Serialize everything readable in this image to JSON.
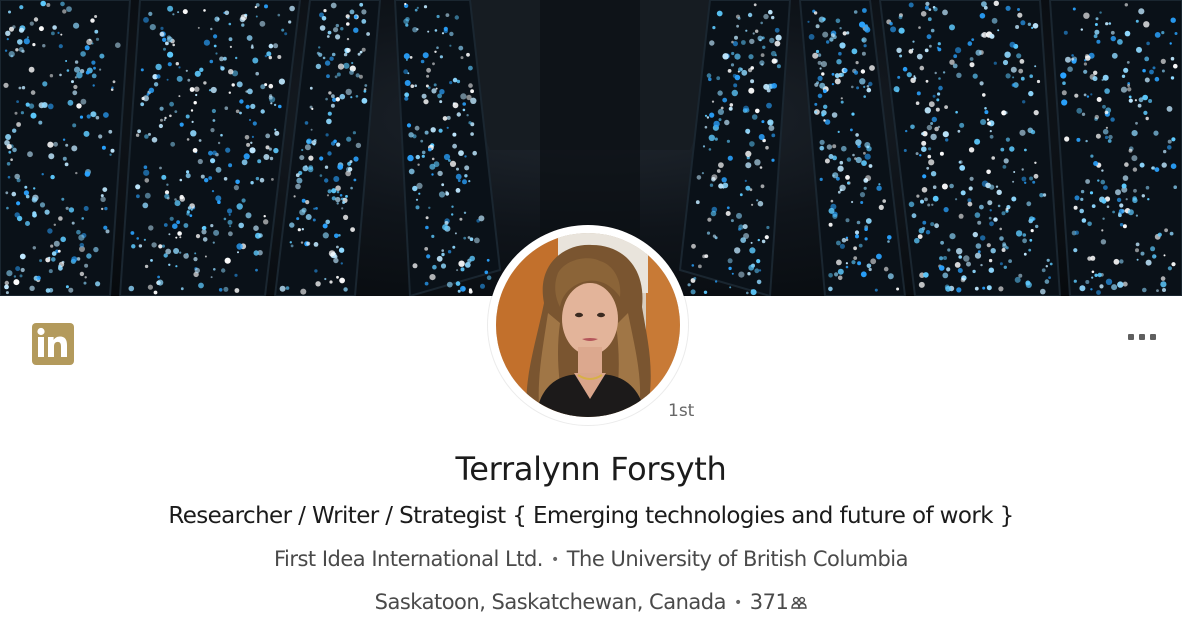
{
  "brand": {
    "logo_text": "in",
    "accent": "#b39a5c"
  },
  "profile": {
    "name": "Terralynn Forsyth",
    "degree": "1st",
    "headline": "Researcher / Writer / Strategist { Emerging technologies and future of work }",
    "company": "First Idea International Ltd.",
    "school": "The University of British Columbia",
    "location": "Saskatoon, Saskatchewan, Canada",
    "connections": "371",
    "separator": "•"
  },
  "icons": {
    "more": "more-horizontal-icon",
    "connections": "people-icon",
    "logo": "linkedin-logo-icon"
  }
}
